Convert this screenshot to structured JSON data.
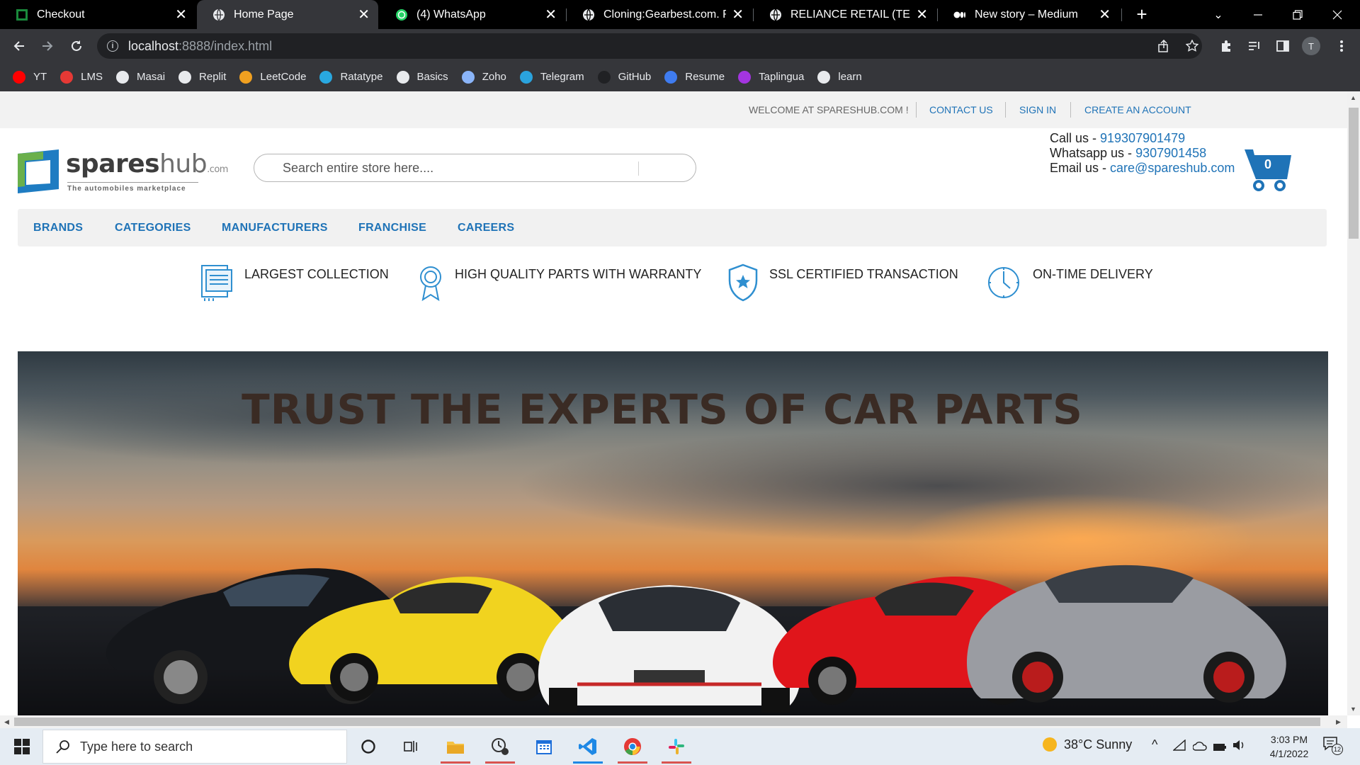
{
  "browser": {
    "tabs": [
      {
        "title": "Checkout",
        "active": false,
        "icon": "square-logo-icon"
      },
      {
        "title": "Home Page",
        "active": true,
        "icon": "globe-icon"
      },
      {
        "title": "(4) WhatsApp",
        "active": false,
        "icon": "whatsapp-icon"
      },
      {
        "title": "Cloning:Gearbest.com. Rea",
        "active": false,
        "icon": "globe-icon"
      },
      {
        "title": "RELIANCE RETAIL (TEAM —",
        "active": false,
        "icon": "globe-icon"
      },
      {
        "title": "New story – Medium",
        "active": false,
        "icon": "medium-icon"
      }
    ],
    "new_tab_label": "+",
    "url_host": "localhost",
    "url_path": ":8888/index.html",
    "profile_initial": "T",
    "bookmarks": [
      {
        "label": "YT",
        "icon": "youtube-icon",
        "color": "#ff0000"
      },
      {
        "label": "LMS",
        "icon": "lms-icon",
        "color": "#e53935"
      },
      {
        "label": "Masai",
        "icon": "globe-icon",
        "color": "#e8eaed"
      },
      {
        "label": "Replit",
        "icon": "replit-icon",
        "color": "#e8eaed"
      },
      {
        "label": "LeetCode",
        "icon": "leetcode-icon",
        "color": "#f0a020"
      },
      {
        "label": "Ratatype",
        "icon": "ratatype-icon",
        "color": "#29a8e0"
      },
      {
        "label": "Basics",
        "icon": "m-icon",
        "color": "#e8eaed"
      },
      {
        "label": "Zoho",
        "icon": "zoho-icon",
        "color": "#8ab4f8"
      },
      {
        "label": "Telegram",
        "icon": "telegram-icon",
        "color": "#2aa3dd"
      },
      {
        "label": "GitHub",
        "icon": "github-icon",
        "color": "#202124"
      },
      {
        "label": "Resume",
        "icon": "resume-icon",
        "color": "#3f7cf0"
      },
      {
        "label": "Taplingua",
        "icon": "star-icon",
        "color": "#a335e0"
      },
      {
        "label": "learn",
        "icon": "globe-icon",
        "color": "#e8eaed"
      }
    ]
  },
  "site": {
    "top_bar": {
      "welcome": "WELCOME AT SPARESHUB.COM !",
      "links": [
        "CONTACT US",
        "SIGN IN",
        "CREATE AN ACCOUNT"
      ]
    },
    "logo": {
      "name_a": "spares",
      "name_b": "hub",
      "suffix": ".com",
      "tagline": "The automobiles marketplace"
    },
    "search_placeholder": "Search entire store here....",
    "contact": {
      "call_label": "Call us - ",
      "call_value": "919307901479",
      "whatsapp_label": "Whatsapp us - ",
      "whatsapp_value": "9307901458",
      "email_label": "Email us - ",
      "email_value": "care@spareshub.com"
    },
    "cart_count": "0",
    "nav": [
      "BRANDS",
      "CATEGORIES",
      "MANUFACTURERS",
      "FRANCHISE",
      "CAREERS"
    ],
    "features": [
      {
        "label": "LARGEST COLLECTION",
        "icon": "catalog-icon"
      },
      {
        "label": "HIGH QUALITY PARTS WITH WARRANTY",
        "icon": "award-badge-icon"
      },
      {
        "label": "SSL CERTIFIED TRANSACTION",
        "icon": "shield-star-icon"
      },
      {
        "label": "ON-TIME DELIVERY",
        "icon": "clock-icon"
      }
    ],
    "hero_title": "TRUST THE EXPERTS OF CAR PARTS",
    "accent_color": "#1f73b7"
  },
  "taskbar": {
    "search_placeholder": "Type here to search",
    "weather": "38°C  Sunny",
    "time": "3:03 PM",
    "date": "4/1/2022",
    "notifications": "12"
  }
}
